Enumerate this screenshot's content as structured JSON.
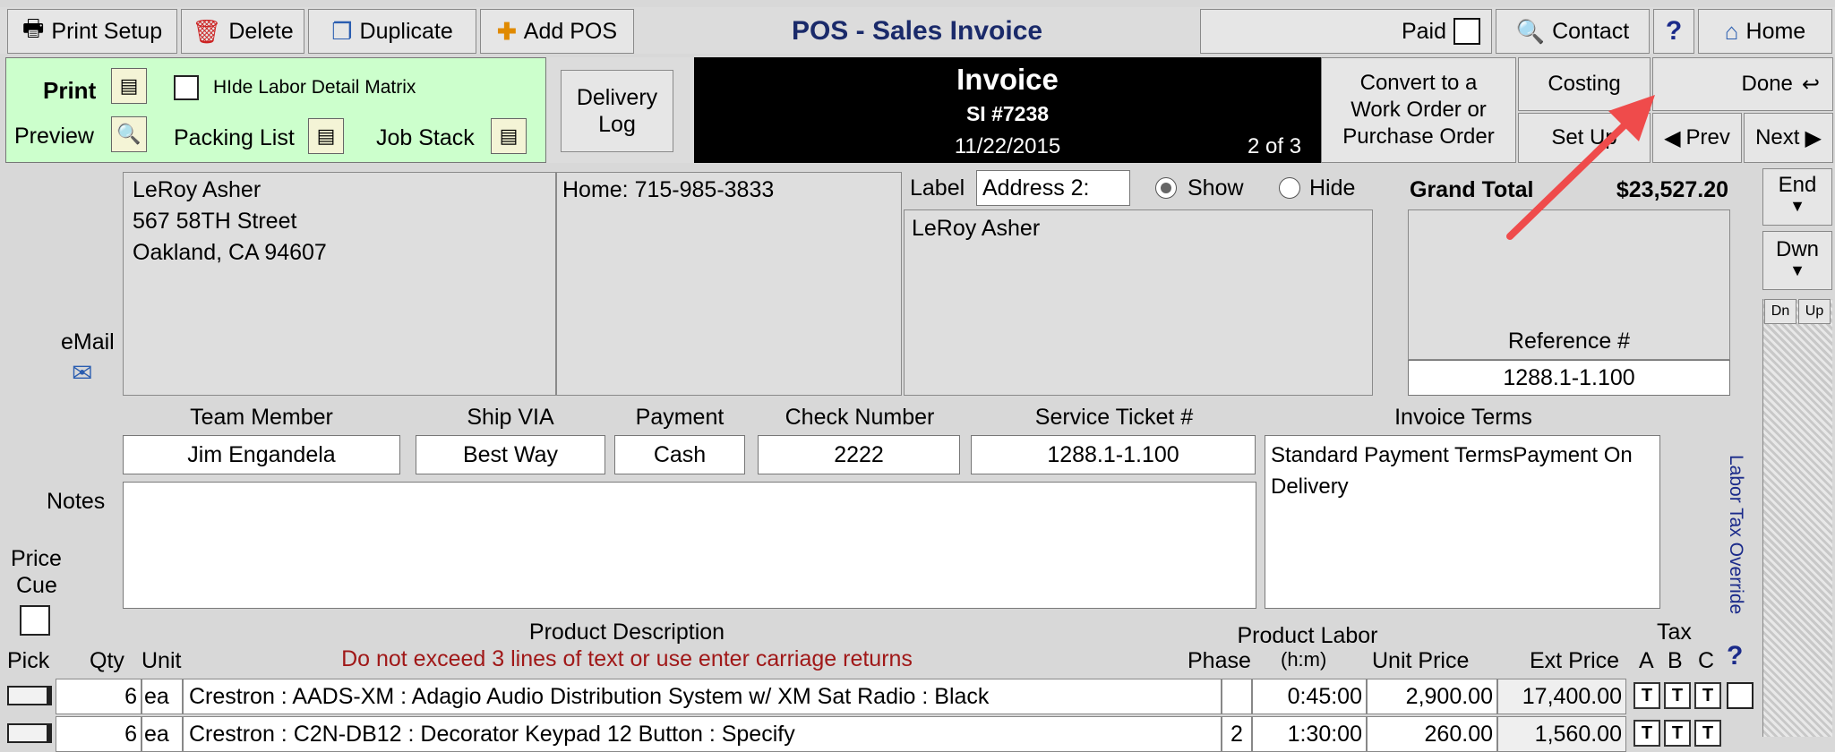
{
  "toolbar": {
    "print_setup": "Print Setup",
    "delete": "Delete",
    "duplicate": "Duplicate",
    "add_pos": "Add POS",
    "title": "POS - Sales Invoice",
    "paid": "Paid",
    "contact": "Contact",
    "help": "?",
    "home": "Home"
  },
  "print_panel": {
    "print": "Print",
    "hide_labor": "HIde Labor Detail Matrix",
    "preview": "Preview",
    "packing_list": "Packing List",
    "job_stack": "Job Stack"
  },
  "delivery_log": {
    "line1": "Delivery",
    "line2": "Log"
  },
  "invoice": {
    "heading": "Invoice",
    "number": "SI #7238",
    "date": "11/22/2015",
    "position": "2 of 3"
  },
  "actions": {
    "convert_line1": "Convert to a",
    "convert_line2": "Work Order or",
    "convert_line3": "Purchase Order",
    "costing": "Costing",
    "setup": "Set Up",
    "done": "Done",
    "prev": "Prev",
    "next": "Next"
  },
  "customer": {
    "name": "LeRoy Asher",
    "street": "567 58TH Street",
    "city": "Oakland, CA 94607",
    "phone": "Home: 715-985-3833",
    "email_label": "eMail"
  },
  "ship_address": {
    "label": "Label",
    "label_value": "Address 2:",
    "show": "Show",
    "hide": "Hide",
    "name": "LeRoy Asher"
  },
  "totals": {
    "grand_total_label": "Grand Total",
    "grand_total": "$23,527.20",
    "reference_label": "Reference #",
    "reference_value": "1288.1-1.100"
  },
  "side_nav": {
    "end": "End",
    "down": "Dwn",
    "dn": "Dn",
    "up": "Up"
  },
  "headers": {
    "team_member": "Team Member",
    "ship_via": "Ship VIA",
    "payment": "Payment",
    "check_number": "Check Number",
    "service_ticket": "Service Ticket #",
    "invoice_terms": "Invoice Terms"
  },
  "fields": {
    "team_member": "Jim Engandela",
    "ship_via": "Best Way",
    "payment": "Cash",
    "check_number": "2222",
    "service_ticket": "1288.1-1.100",
    "invoice_terms": "Standard Payment TermsPayment On Delivery"
  },
  "notes_label": "Notes",
  "price_cue": {
    "line1": "Price",
    "line2": "Cue"
  },
  "labor_tax_override": "Labor Tax Override",
  "columns": {
    "product_description": "Product Description",
    "warning": "Do not exceed 3 lines of text or use enter carriage returns",
    "pick": "Pick",
    "qty": "Qty",
    "unit": "Unit",
    "phase": "Phase",
    "product_labor": "Product Labor",
    "hm": "(h:m)",
    "unit_price": "Unit Price",
    "ext_price": "Ext Price",
    "tax": "Tax",
    "a": "A",
    "b": "B",
    "c": "C",
    "tax_help": "?"
  },
  "line_items": [
    {
      "qty": "6",
      "unit": "ea",
      "description": "Crestron : AADS-XM : Adagio Audio Distribution System w/ XM Sat Radio : Black",
      "phase": "",
      "labor": "0:45:00",
      "unit_price": "2,900.00",
      "ext_price": "17,400.00",
      "ta": "T",
      "tb": "T",
      "tc": "T"
    },
    {
      "qty": "6",
      "unit": "ea",
      "description": "Crestron : C2N-DB12 : Decorator Keypad 12 Button : Specify",
      "phase": "2",
      "labor": "1:30:00",
      "unit_price": "260.00",
      "ext_price": "1,560.00",
      "ta": "T",
      "tb": "T",
      "tc": "T"
    }
  ],
  "colors": {
    "green_panel": "#ccffcc",
    "black_bar": "#000000",
    "warning_text": "#a01818",
    "arrow": "#ef4b4b"
  }
}
